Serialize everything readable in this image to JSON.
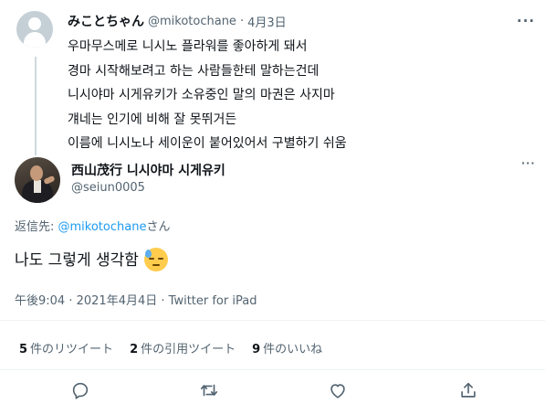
{
  "parent_tweet": {
    "display_name": "みことちゃん",
    "handle": "@mikotochane",
    "separator": "·",
    "date": "4月3日",
    "more_icon": "more-horizontal-icon",
    "lines": [
      "우마무스메로 니시노 플라워를 좋아하게 돼서",
      "경마 시작해보려고 하는 사람들한테 말하는건데",
      "니시야마 시게유키가 소유중인 말의 마권은 사지마",
      "걔네는 인기에 비해 잘 못뛰거든",
      "이름에 니시노나 세이운이 붙어있어서 구별하기 쉬움"
    ]
  },
  "reply_tweet": {
    "display_name": "西山茂行 니시야마 시게유키",
    "handle": "@seiun0005",
    "more_icon": "more-horizontal-icon",
    "replying_prefix": "返信先: ",
    "replying_mention": "@mikotochane",
    "replying_suffix": "さん",
    "text": "나도 그렇게 생각함",
    "emoji": "downcast-face-with-sweat-emoji",
    "time": "午後9:04",
    "meta_separator": " · ",
    "date": "2021年4月4日",
    "source": "Twitter for iPad"
  },
  "stats": [
    {
      "count": "5",
      "label": "件のリツイート"
    },
    {
      "count": "2",
      "label": "件の引用ツイート"
    },
    {
      "count": "9",
      "label": "件のいいね"
    }
  ],
  "actions": [
    {
      "name": "reply-icon"
    },
    {
      "name": "retweet-icon"
    },
    {
      "name": "like-icon"
    },
    {
      "name": "share-icon"
    }
  ],
  "colors": {
    "text": "#0f1419",
    "secondary": "#536471",
    "link": "#1d9bf0",
    "divider": "#eff3f4"
  }
}
